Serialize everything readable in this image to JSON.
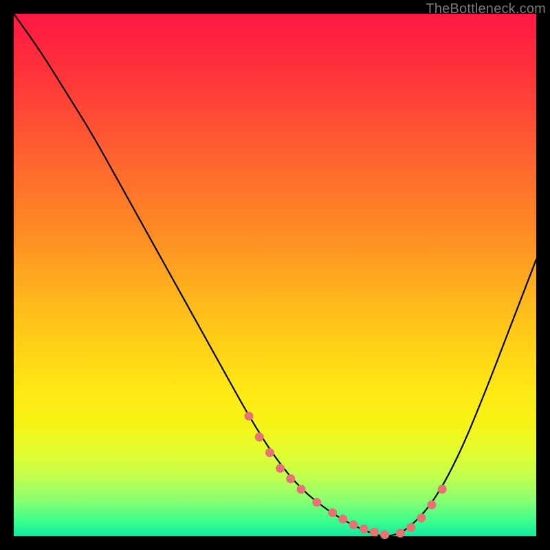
{
  "watermark": "TheBottleneck.com",
  "chart_data": {
    "type": "line",
    "title": "",
    "xlabel": "",
    "ylabel": "",
    "xlim": [
      0,
      100
    ],
    "ylim": [
      0,
      100
    ],
    "grid": false,
    "legend": false,
    "series": [
      {
        "name": "bottleneck-curve",
        "x": [
          0,
          5,
          10,
          15,
          20,
          25,
          30,
          35,
          40,
          45,
          50,
          55,
          60,
          65,
          70,
          72,
          75,
          80,
          85,
          90,
          95,
          100
        ],
        "y": [
          100,
          93,
          85,
          77,
          68,
          59,
          50,
          41,
          32,
          23,
          15,
          9,
          5,
          2,
          0,
          0,
          1,
          6,
          15,
          27,
          40,
          53
        ]
      }
    ],
    "markers": {
      "name": "highlighted-points",
      "color": "#e57373",
      "x": [
        45,
        47,
        49,
        51,
        53,
        55,
        58,
        61,
        63,
        65,
        67,
        69,
        71,
        74,
        76,
        78,
        80,
        82
      ],
      "y": [
        23,
        19,
        16,
        13,
        11,
        9,
        6.5,
        4.5,
        3.3,
        2.2,
        1.4,
        0.8,
        0.3,
        0.6,
        1.7,
        3.5,
        6.0,
        9.0
      ]
    }
  }
}
